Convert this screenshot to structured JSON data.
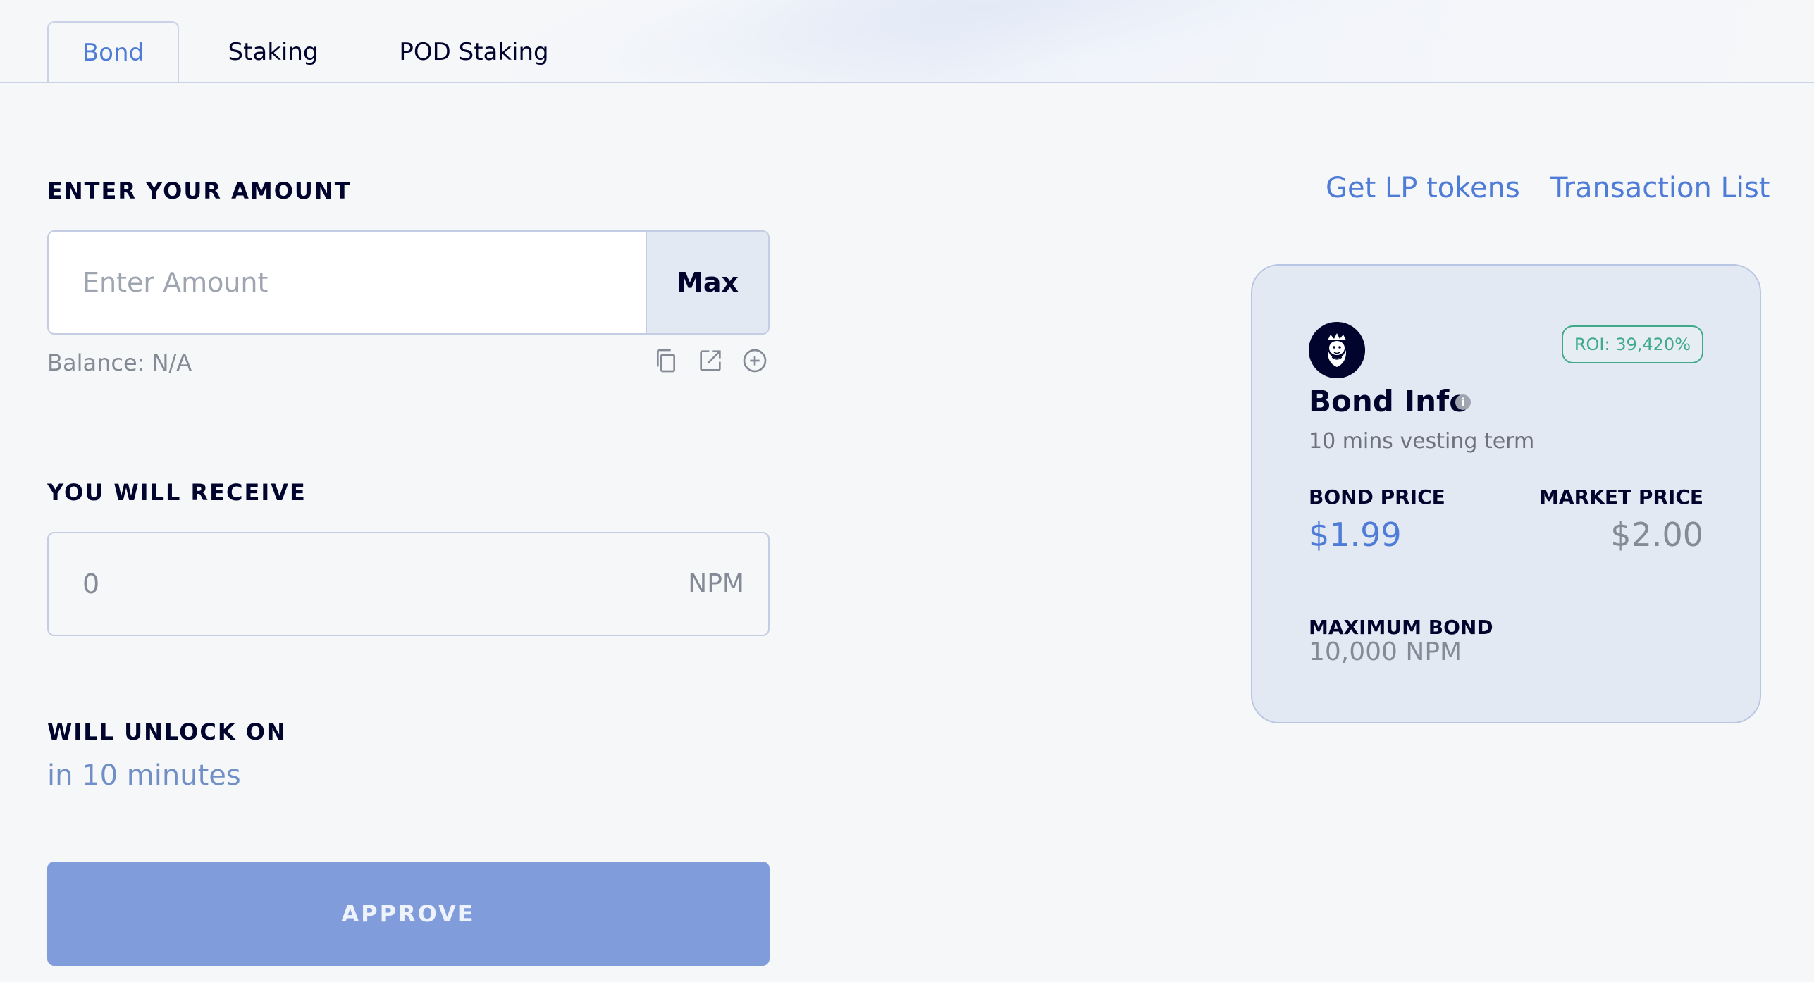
{
  "tabs": [
    {
      "label": "Bond",
      "active": true
    },
    {
      "label": "Staking",
      "active": false
    },
    {
      "label": "POD Staking",
      "active": false
    }
  ],
  "form": {
    "amount_label": "ENTER YOUR AMOUNT",
    "amount_placeholder": "Enter Amount",
    "amount_value": "",
    "max_label": "Max",
    "balance_text": "Balance: N/A",
    "icons": [
      "copy-icon",
      "external-link-icon",
      "add-circle-icon"
    ],
    "receive_label": "YOU WILL RECEIVE",
    "receive_value": "0",
    "receive_unit": "NPM",
    "unlock_label": "WILL UNLOCK ON",
    "unlock_value": "in 10 minutes",
    "approve_label": "APPROVE"
  },
  "links": {
    "lp_tokens": "Get LP tokens",
    "transactions": "Transaction List"
  },
  "bond_info": {
    "roi": "ROI: 39,420%",
    "title": "Bond Info",
    "info_icon_glyph": "i",
    "vesting": "10 mins vesting term",
    "bond_price_label": "BOND PRICE",
    "bond_price": "$1.99",
    "market_price_label": "MARKET PRICE",
    "market_price": "$2.00",
    "max_bond_label": "MAXIMUM BOND",
    "max_bond": "10,000 NPM"
  },
  "colors": {
    "accent": "#4e7cd7",
    "approve_bg": "#809cdb",
    "roi_green": "#3fa98a",
    "card_bg": "#e2e9f3",
    "text_dark": "#01052d",
    "page_bg": "#f6f7f9"
  }
}
